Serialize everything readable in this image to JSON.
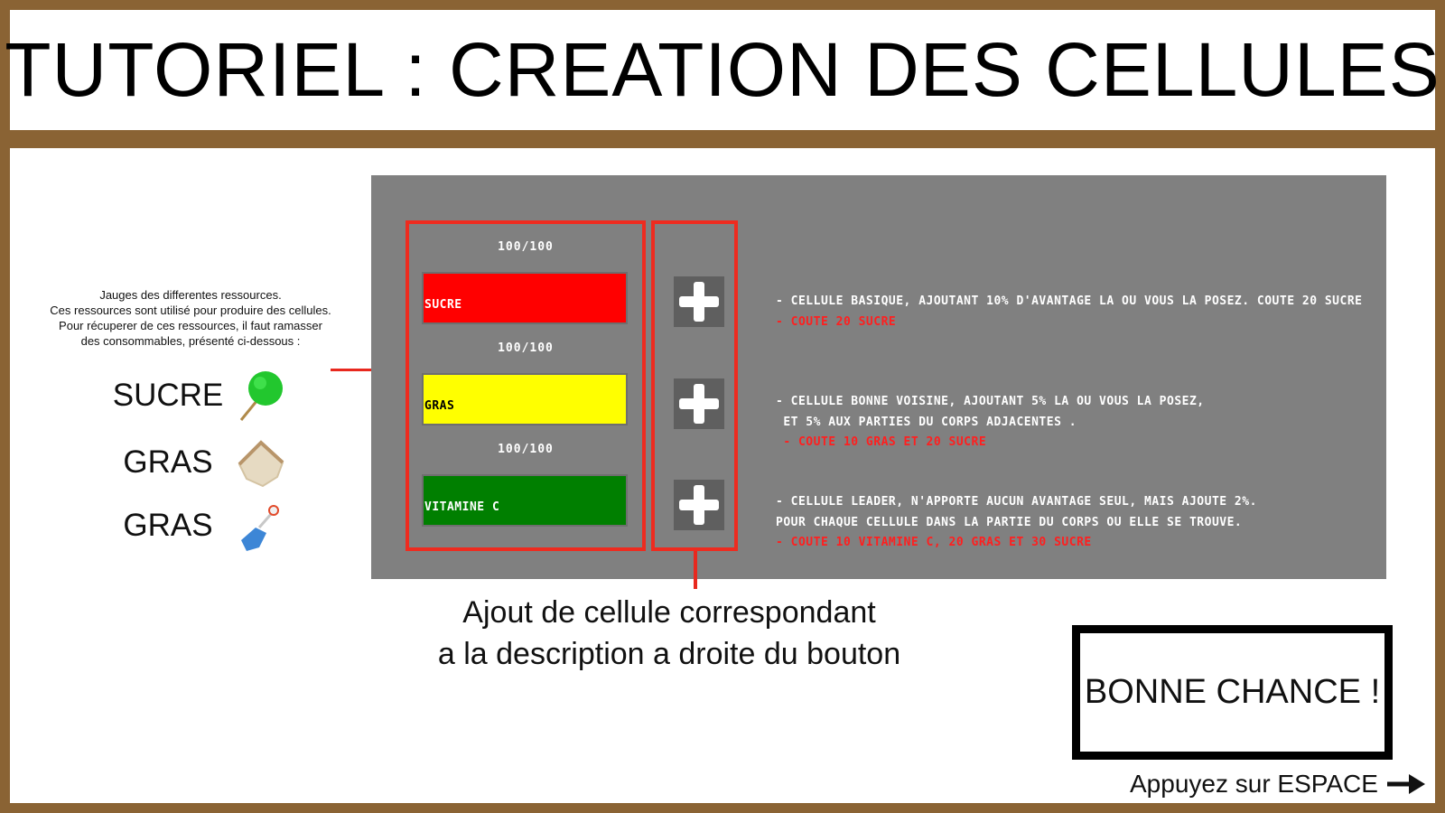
{
  "header": {
    "title": "TUTORIEL : CREATION DES CELLULES"
  },
  "gauge_info": {
    "line1": "Jauges des differentes ressources.",
    "line2": "Ces ressources sont utilisé pour produire des cellules.",
    "line3": "Pour récuperer de ces ressources, il faut ramasser",
    "line4": "des consommables, présenté ci-dessous :"
  },
  "resources": [
    {
      "name": "SUCRE",
      "icon": "green-lollipop-icon"
    },
    {
      "name": "GRAS",
      "icon": "bread-slice-icon"
    },
    {
      "name": "GRAS",
      "icon": "blue-bottle-icon"
    }
  ],
  "gauges": [
    {
      "value_text": "100/100",
      "label": "SUCRE",
      "fill_fraction": 1.0,
      "color": "#ff0000",
      "label_color": "#ffffff"
    },
    {
      "value_text": "100/100",
      "label": "GRAS",
      "fill_fraction": 1.0,
      "color": "#ffff00",
      "label_color": "#000000"
    },
    {
      "value_text": "100/100",
      "label": "VITAMINE C",
      "fill_fraction": 1.0,
      "color": "#007f00",
      "label_color": "#ffffff"
    }
  ],
  "cells": [
    {
      "lines": [
        "- CELLULE BASIQUE, AJOUTANT 10% D'AVANTAGE LA OU VOUS LA POSEZ. COUTE 20 SUCRE"
      ],
      "cost": "- COUTE 20 SUCRE"
    },
    {
      "lines": [
        "- CELLULE BONNE VOISINE, AJOUTANT 5% LA OU VOUS LA POSEZ,",
        " ET 5% AUX PARTIES DU CORPS ADJACENTES ."
      ],
      "cost": " - COUTE 10 GRAS ET 20 SUCRE"
    },
    {
      "lines": [
        "- CELLULE LEADER, N'APPORTE AUCUN AVANTAGE SEUL, MAIS AJOUTE 2%.",
        "POUR CHAQUE CELLULE DANS LA PARTIE DU CORPS OU ELLE SE TROUVE."
      ],
      "cost": "- COUTE 10 VITAMINE C, 20 GRAS ET 30 SUCRE"
    }
  ],
  "caption": {
    "line1": "Ajout de cellule correspondant",
    "line2": "a la description a droite du bouton"
  },
  "good_luck": "BONNE CHANCE !",
  "press_space": "Appuyez sur ESPACE",
  "colors": {
    "frame": "#8a6334",
    "panel": "#808080",
    "highlight": "#ee2b1f",
    "cost": "#ff1f1f"
  }
}
